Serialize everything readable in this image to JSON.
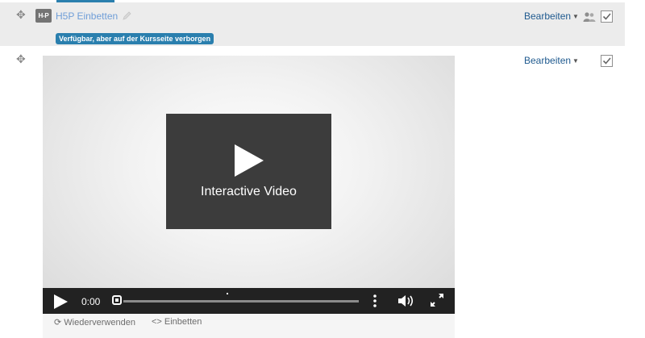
{
  "activity1": {
    "name": "H5P Einbetten",
    "logo_text": "H-P",
    "badge": "Verfügbar, aber auf der Kursseite verborgen",
    "edit_label": "Bearbeiten",
    "icons": [
      "move-icon",
      "h5p-logo-icon",
      "pencil-icon",
      "caret-down-icon",
      "group-mode-icon",
      "completion-checkbox-icon"
    ]
  },
  "activity2": {
    "edit_label": "Bearbeiten",
    "icons": [
      "move-icon",
      "caret-down-icon",
      "completion-checkbox-icon"
    ]
  },
  "player": {
    "title": "Interactive Video",
    "time": "0:00",
    "progress": 0,
    "icons": [
      "play-icon",
      "bookmark-icon",
      "more-options-icon",
      "volume-icon",
      "fullscreen-icon"
    ]
  },
  "footer": {
    "reuse": "Wiederverwenden",
    "embed": "Einbetten"
  },
  "colors": {
    "row_background": "#ececec",
    "badge": "#2a7fae",
    "link": "#1f5a8f",
    "activity_name": "#6f9ed8",
    "splash": "#3c3c3c",
    "controls": "#222222"
  }
}
